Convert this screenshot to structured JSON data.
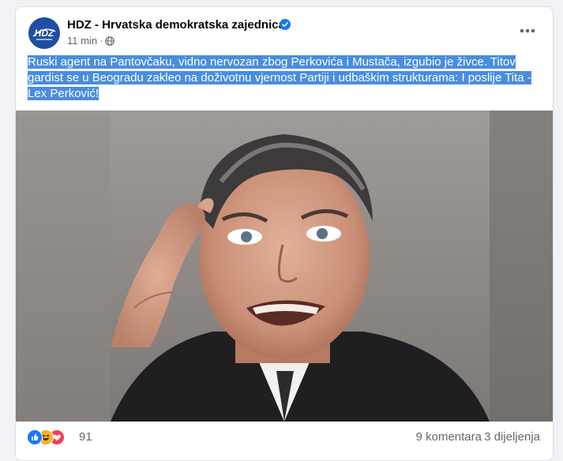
{
  "post": {
    "author": "HDZ - Hrvatska demokratska zajednica",
    "avatar_text": "HDZ",
    "time": "11 min",
    "separator": "·",
    "text": "Ruski agent na Pantovčaku, vidno nervozan zbog Perkovića i Mustača, izgubio je živce. Titov gardist se u Beogradu zakleo na doživotnu vjernost Partiji i udbaškim strukturama: I poslije Tita - Lex Perković!",
    "verified": true,
    "audience_icon": "globe-icon"
  },
  "stats": {
    "reaction_count": "91",
    "comments": "9 komentara",
    "shares": "3 dijeljenja",
    "reaction_icons": [
      "like-icon",
      "haha-icon",
      "love-icon"
    ]
  },
  "colors": {
    "brand_blue": "#1e4fa3",
    "selection": "#4a8ddf",
    "like": "#1877f2",
    "haha": "#f7b125",
    "love": "#f33e58"
  }
}
